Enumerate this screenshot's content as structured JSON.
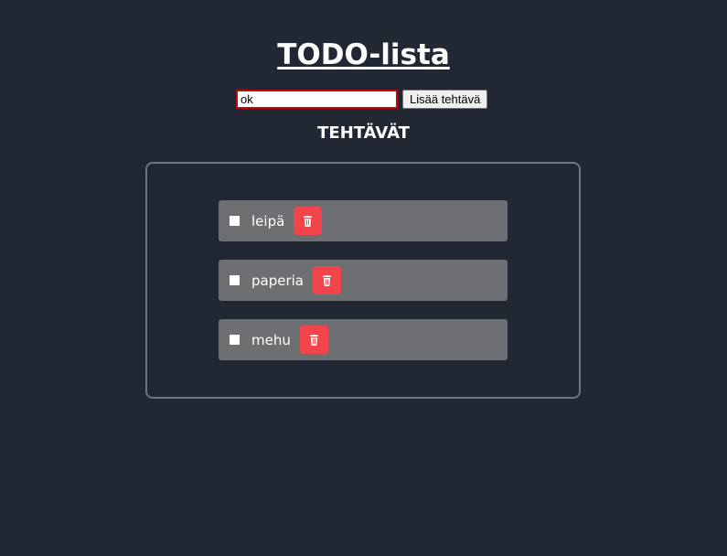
{
  "header": {
    "title": "TODO-lista"
  },
  "add_form": {
    "input_value": "ok",
    "button_label": "Lisää tehtävä"
  },
  "list": {
    "heading": "TEHTÄVÄT",
    "items": [
      {
        "label": "leipä",
        "done": false
      },
      {
        "label": "paperia",
        "done": false
      },
      {
        "label": "mehu",
        "done": false
      }
    ]
  },
  "icons": {
    "delete": "trash-icon",
    "checkbox": "checkbox-icon"
  },
  "colors": {
    "background": "#212733",
    "item_background": "#6d6f73",
    "delete_button": "#f1454b",
    "input_border": "#c4070f",
    "panel_border": "#6f7480"
  }
}
